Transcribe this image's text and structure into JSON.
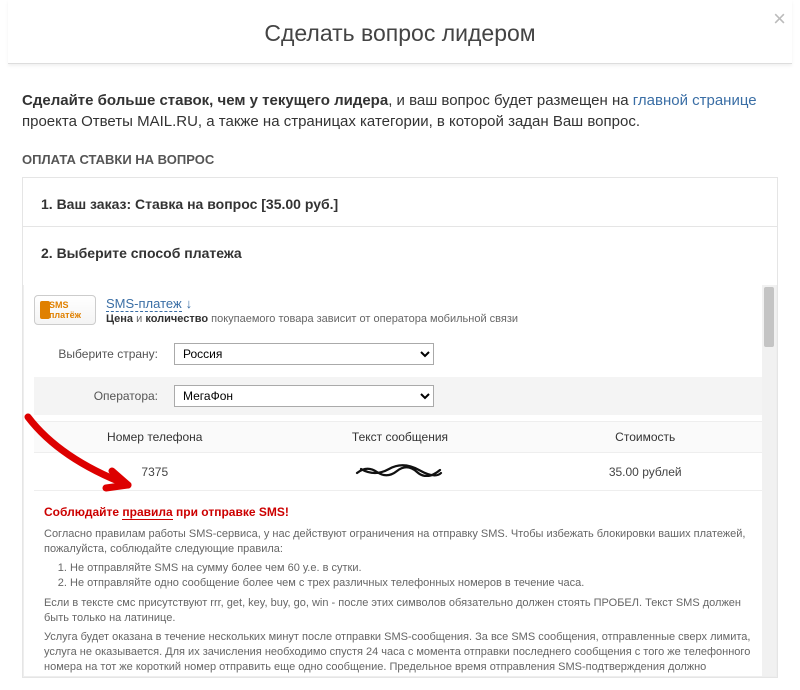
{
  "modal": {
    "title": "Сделать вопрос лидером",
    "close_glyph": "×"
  },
  "intro": {
    "bold": "Сделайте больше ставок, чем у текущего лидера",
    "mid1": ", и ваш вопрос будет размещен на  ",
    "link1": "главной странице",
    "mid2": "  проекта Ответы MAIL.RU, а также на страницах категории, в которой задан Ваш вопрос."
  },
  "section_label": "ОПЛАТА СТАВКИ НА ВОПРОС",
  "steps": {
    "s1": "1. Ваш заказ: Ставка на вопрос [35.00 руб.]",
    "s2": "2. Выберите способ платежа"
  },
  "sms": {
    "badge": "SMS платёж",
    "link": "SMS-платеж",
    "arrow": "↓",
    "sub_pre": "Цена",
    "sub_mid": " и ",
    "sub_b2": "количество",
    "sub_tail": " покупаемого товара зависит от оператора мобильной связи"
  },
  "form": {
    "country_label": "Выберите страну:",
    "country_value": "Россия",
    "operator_label": "Оператора:",
    "operator_value": "МегаФон"
  },
  "table": {
    "h_phone": "Номер телефона",
    "h_text": "Текст сообщения",
    "h_cost": "Стоимость",
    "row": {
      "phone": "7375",
      "cost": "35.00 рублей"
    }
  },
  "warn": {
    "pre": "Соблюдайте ",
    "u": "правила",
    "post": " при отправке SMS!"
  },
  "rules": {
    "p1": "Согласно правилам работы SMS-сервиса, у нас действуют ограничения на отправку SMS. Чтобы избежать блокировки ваших платежей, пожалуйста, соблюдайте следующие правила:",
    "li1": "Не отправляйте SMS на сумму более чем 60 у.е. в сутки.",
    "li2": "Не отправляйте одно сообщение более чем с трех различных телефонных номеров в течение часа.",
    "p2": "Если в тексте смс присутствуют rrr, get, key, buy, go, win - после этих символов обязательно должен стоять ПРОБЕЛ. Текст SMS должен быть только на латинице.",
    "p3": "Услуга будет оказана в течение нескольких минут после отправки SMS-сообщения. За все SMS сообщения, отправленные сверх лимита, услуга не оказывается. Для их зачисления необходимо спустя 24 часа с момента отправки последнего сообщения с того же телефонного номера на тот же короткий номер отправить еще одно сообщение. Предельное время отправления SMS-подтверждения должно составлять не более двух недель с момента отправки первого сообщения. Приносим извинения за возможные неудобства."
  }
}
